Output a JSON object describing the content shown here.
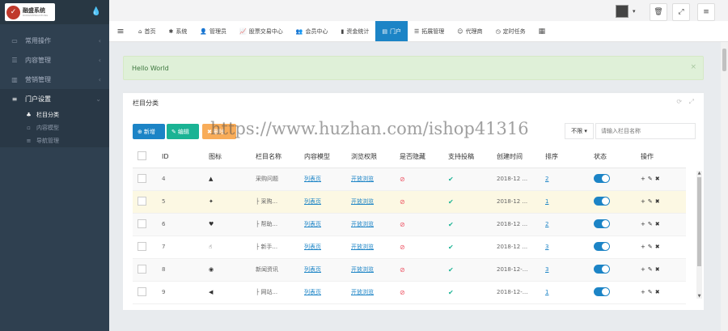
{
  "logo": {
    "name": "融盛系统",
    "sub": "RONGSHENGXITONG"
  },
  "sidebar": {
    "items": [
      {
        "label": "常用操作",
        "icon": "desktop-icon"
      },
      {
        "label": "内容管理",
        "icon": "list-icon"
      },
      {
        "label": "营销管理",
        "icon": "book-icon"
      },
      {
        "label": "门户设置",
        "icon": "sliders-icon"
      }
    ],
    "sub_items": [
      {
        "label": "栏目分类",
        "icon": "sitemap-icon"
      },
      {
        "label": "内容模型",
        "icon": "file-icon"
      },
      {
        "label": "导航管理",
        "icon": "menu-icon"
      }
    ]
  },
  "tabs": [
    {
      "label": "首页",
      "icon": "home"
    },
    {
      "label": "系统",
      "icon": "gear"
    },
    {
      "label": "管理员",
      "icon": "user"
    },
    {
      "label": "股票交易中心",
      "icon": "chart"
    },
    {
      "label": "会员中心",
      "icon": "users"
    },
    {
      "label": "资金统计",
      "icon": "bars"
    },
    {
      "label": "门户",
      "icon": "window"
    },
    {
      "label": "拓展管理",
      "icon": "list"
    },
    {
      "label": "代理商",
      "icon": "person"
    },
    {
      "label": "定时任务",
      "icon": "clock"
    }
  ],
  "alert": {
    "text": "Hello World"
  },
  "panel": {
    "title": "栏目分类",
    "buttons": {
      "add": "新增",
      "edit": "编辑",
      "del": "删除"
    },
    "filter": {
      "select": "不限",
      "placeholder": "请输入栏目名称"
    }
  },
  "watermark": "https://www.huzhan.com/ishop41316",
  "table": {
    "headers": [
      "",
      "ID",
      "图标",
      "栏目名称",
      "内容模型",
      "浏览权限",
      "是否隐藏",
      "支持投稿",
      "创建时间",
      "排序",
      "状态",
      "操作"
    ],
    "rows": [
      {
        "id": "4",
        "name": "采购问题",
        "model": "列表页",
        "perm": "开放浏览",
        "time": "2018-12 ...",
        "sort": "2"
      },
      {
        "id": "5",
        "name": "├ 采购...",
        "model": "列表页",
        "perm": "开放浏览",
        "time": "2018-12 ...",
        "sort": "1"
      },
      {
        "id": "6",
        "name": "├ 帮助...",
        "model": "列表页",
        "perm": "开放浏览",
        "time": "2018-12 ...",
        "sort": "2"
      },
      {
        "id": "7",
        "name": "├ 新手...",
        "model": "列表页",
        "perm": "开放浏览",
        "time": "2018-12 ...",
        "sort": "3"
      },
      {
        "id": "8",
        "name": "新闻资讯",
        "model": "列表页",
        "perm": "开放浏览",
        "time": "2018-12-...",
        "sort": "3"
      },
      {
        "id": "9",
        "name": "├ 网站...",
        "model": "列表页",
        "perm": "开放浏览",
        "time": "2018-12-...",
        "sort": "1"
      }
    ]
  },
  "colors": {
    "primary": "#1c84c6",
    "success": "#1ab394",
    "warning": "#f8ac59",
    "danger": "#ed5565",
    "sidebar": "#2f4050"
  }
}
